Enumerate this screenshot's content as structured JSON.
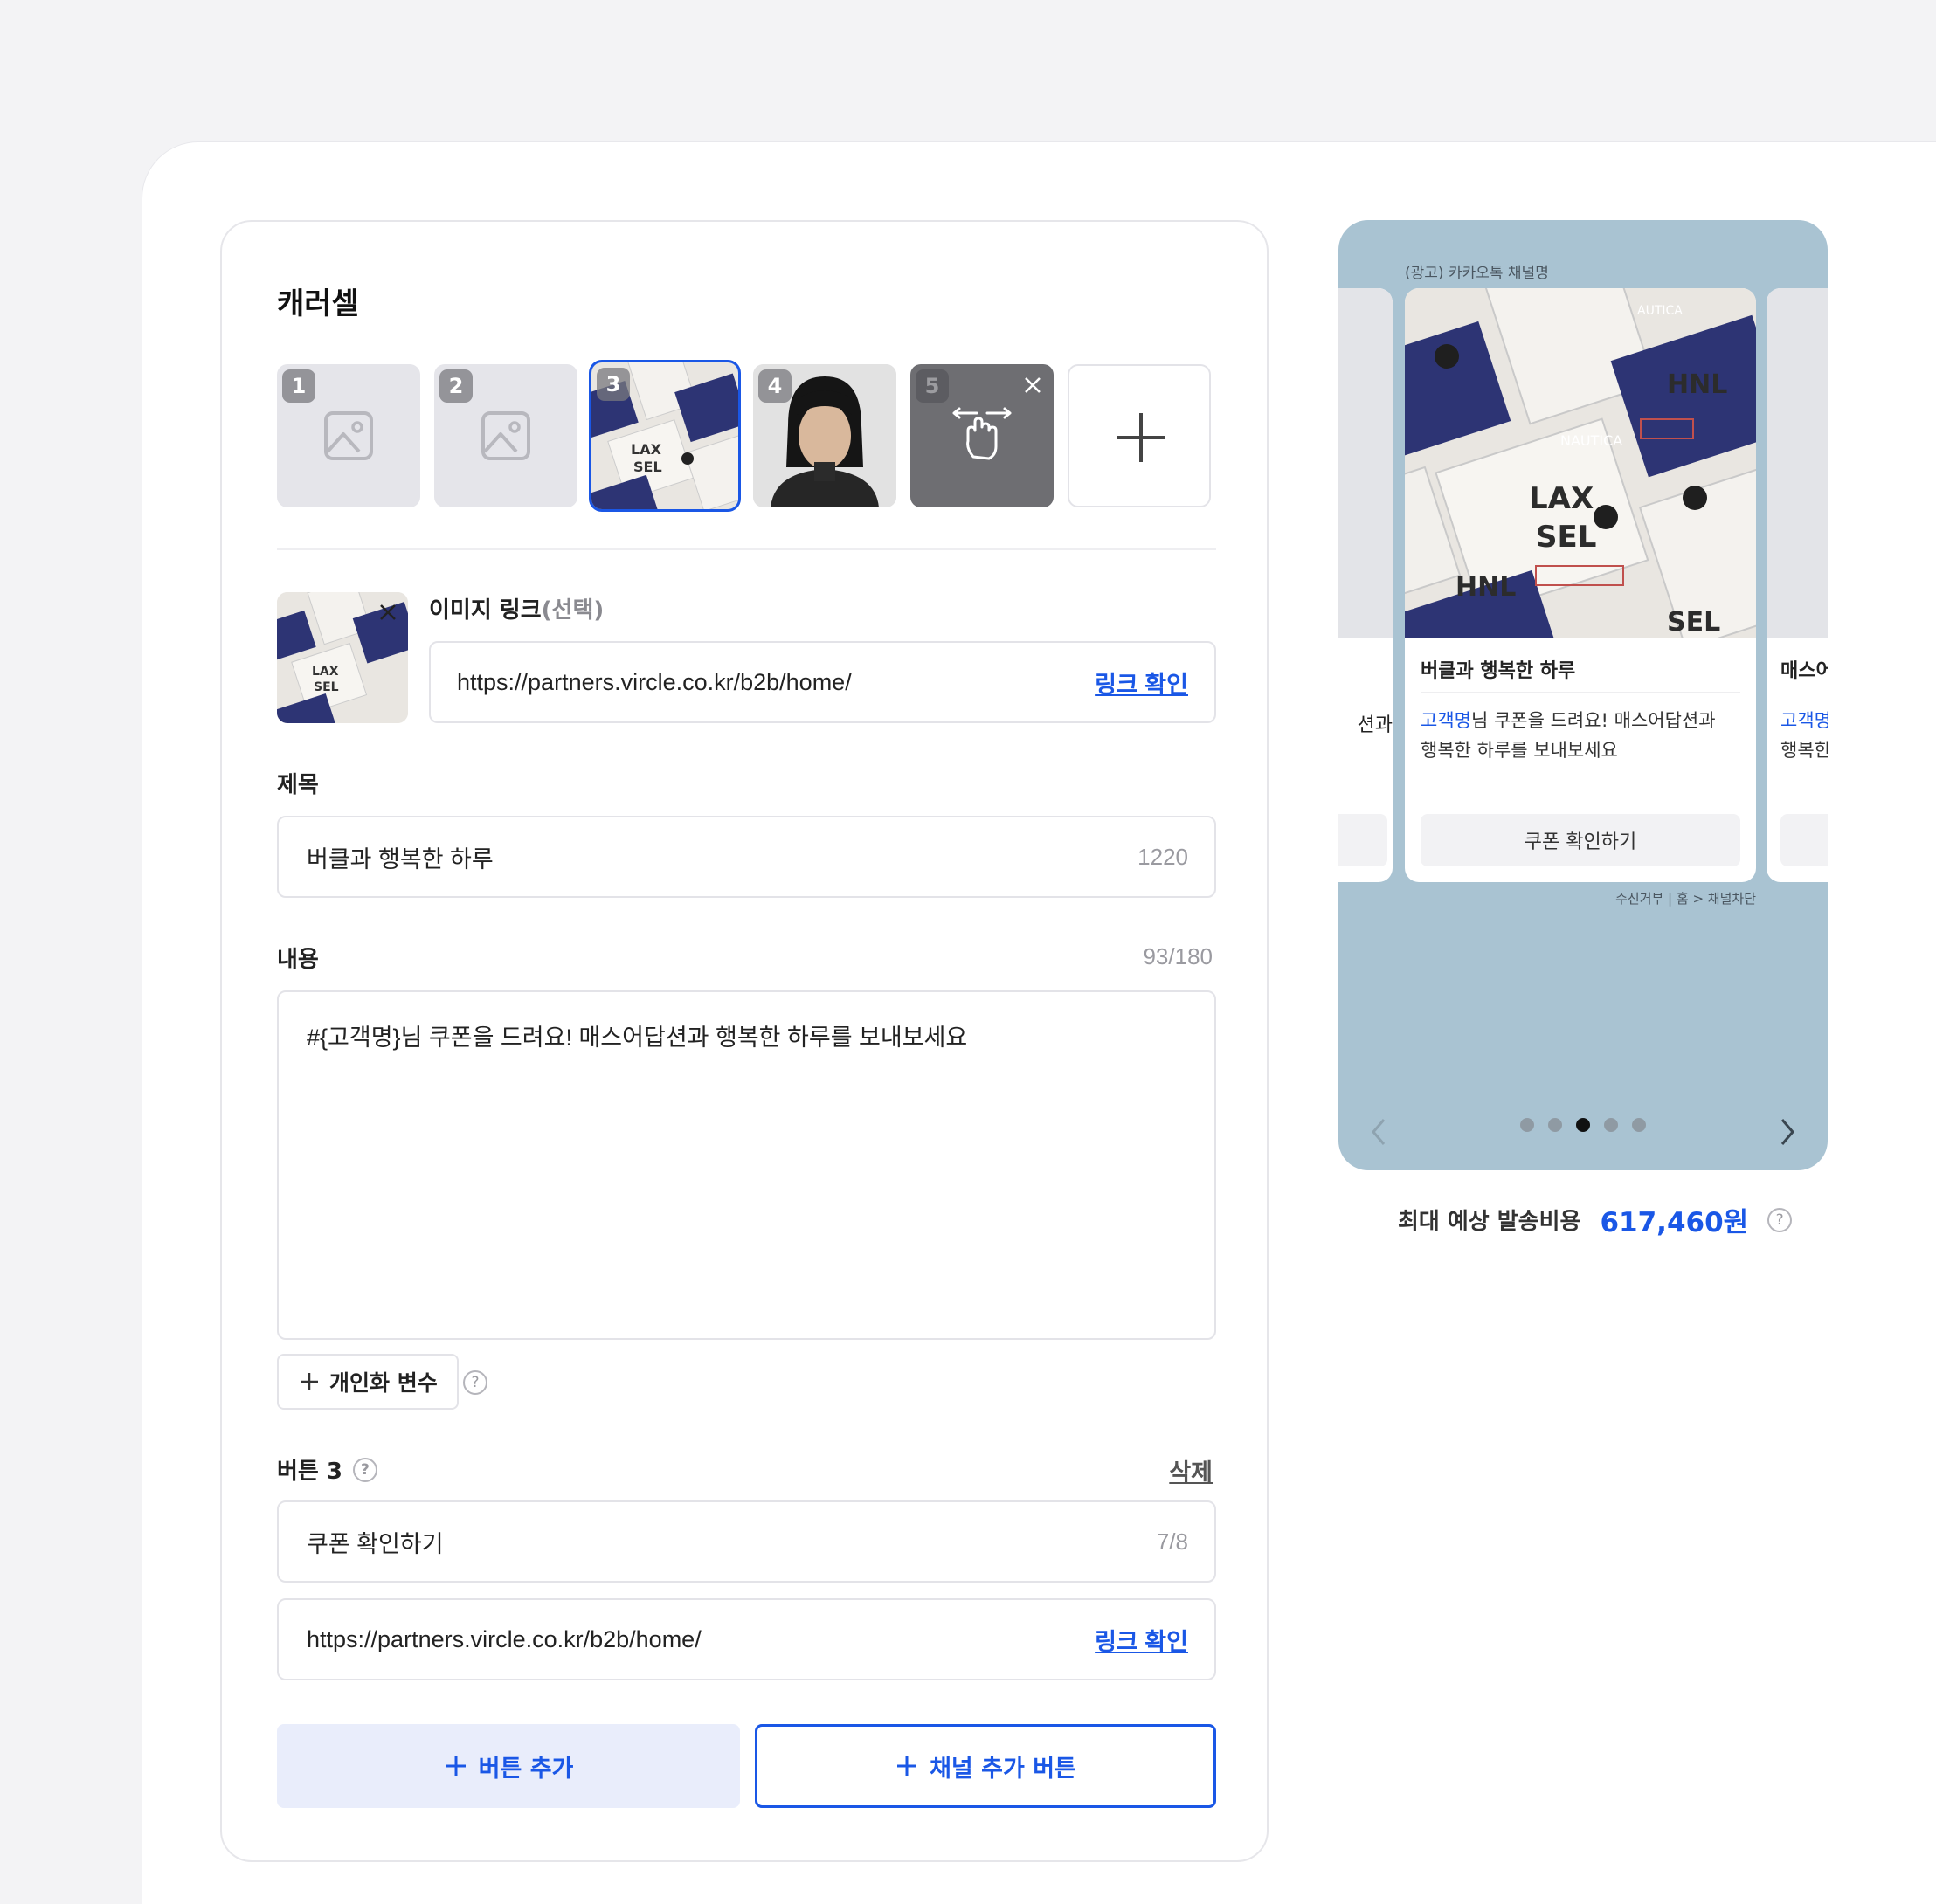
{
  "carousel": {
    "title": "캐러셀",
    "slides": [
      {
        "number": "1",
        "kind": "placeholder"
      },
      {
        "number": "2",
        "kind": "placeholder"
      },
      {
        "number": "3",
        "kind": "image",
        "selected": true
      },
      {
        "number": "4",
        "kind": "portrait"
      },
      {
        "number": "5",
        "kind": "dragging"
      }
    ]
  },
  "image_link": {
    "label": "이미지 링크",
    "label_optional": "(선택)",
    "value": "https://partners.vircle.co.kr/b2b/home/",
    "check_label": "링크 확인"
  },
  "title_field": {
    "label": "제목",
    "value": "버클과 행복한 하루",
    "count": "1220"
  },
  "content_field": {
    "label": "내용",
    "count": "93/180",
    "value": "#{고객명}님 쿠폰을 드려요! 매스어답션과 행복한 하루를 보내보세요"
  },
  "personalize": {
    "label": "개인화 변수"
  },
  "button3": {
    "label": "버튼 3",
    "delete_label": "삭제",
    "name_value": "쿠폰 확인하기",
    "name_count": "7/8",
    "url_value": "https://partners.vircle.co.kr/b2b/home/",
    "check_label": "링크 확인"
  },
  "actions": {
    "add_button": "버튼 추가",
    "add_channel_button": "채널 추가 버튼"
  },
  "preview": {
    "channel_name": "(광고) 카카오톡 채널명",
    "card_title": "버클과 행복한 하루",
    "body_highlight": "고객명",
    "body_rest_line1": "님 쿠폰을 드려요! 매스어답션과",
    "body_line2": "행복한 하루를 보내보세요",
    "button_label": "쿠폰 확인하기",
    "footer": "수신거부 | 홈 > 채널차단",
    "left_peek_text": "션과",
    "right_peek_title": "매스어",
    "right_peek_highlight": "고객명",
    "right_peek_line2": "행복한",
    "active_dot": 3,
    "dot_count": 5
  },
  "cost": {
    "label": "최대 예상 발송비용",
    "value": "617,460원"
  },
  "colors": {
    "accent": "#1a57e6",
    "preview_bg": "#a9c3d2"
  }
}
